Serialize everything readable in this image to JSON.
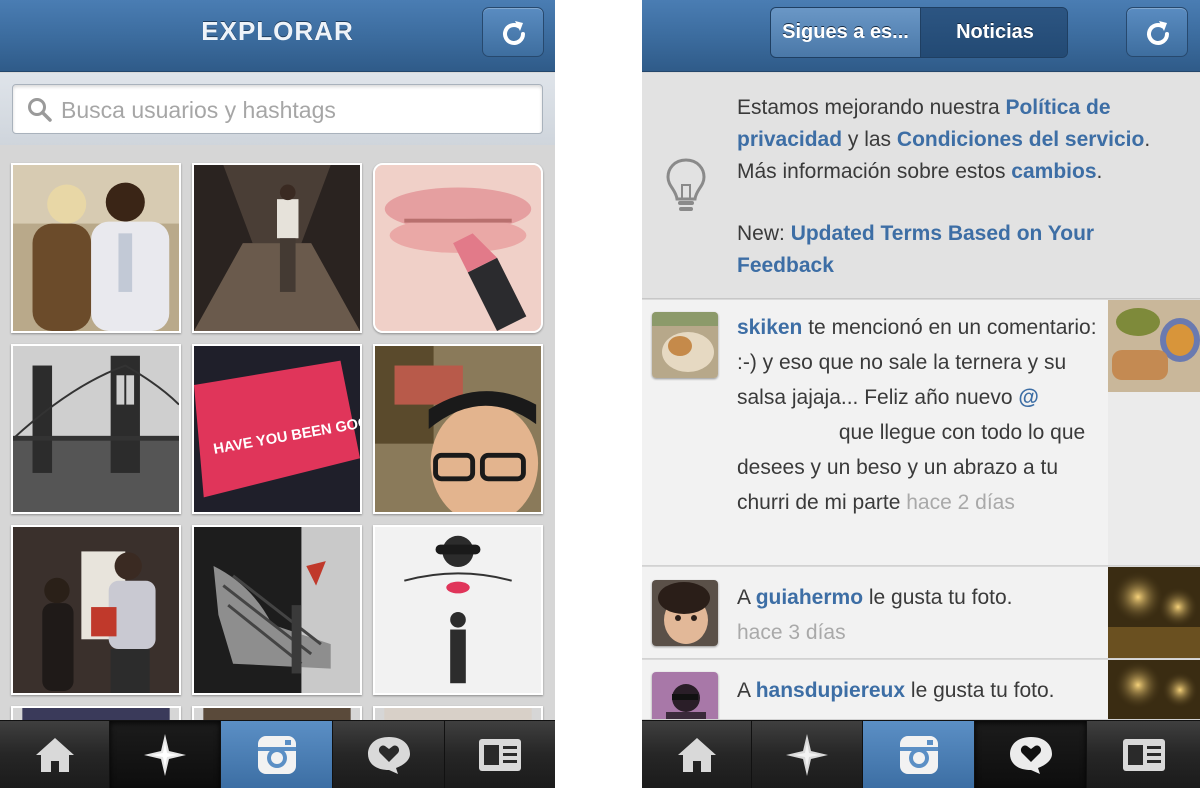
{
  "explore": {
    "title": "EXPLORAR",
    "search": {
      "placeholder": "Busca usuarios y hashtags"
    },
    "grid_tiles": [
      {
        "icon": "photo-couple"
      },
      {
        "icon": "photo-corridor"
      },
      {
        "icon": "photo-lips-lipstick"
      },
      {
        "icon": "photo-brooklyn-bridge"
      },
      {
        "icon": "photo-card",
        "text": "HAVE YOU BEEN GOOD THIS YEAR?"
      },
      {
        "icon": "photo-selfie-glasses"
      },
      {
        "icon": "photo-mirror-selfie"
      },
      {
        "icon": "photo-high-heel"
      },
      {
        "icon": "photo-fashion-sketch"
      }
    ]
  },
  "news": {
    "tabs": [
      {
        "label": "Sigues a es..."
      },
      {
        "label": "Noticias"
      }
    ],
    "notice": {
      "t1": "Estamos mejorando nuestra ",
      "link1": "Política de privacidad",
      "t2": " y las ",
      "link2": "Condiciones del servicio",
      "t3": ". Más información sobre estos ",
      "link3": "cambios",
      "t4": ".",
      "new_prefix": "New: ",
      "new_link": "Updated Terms Based on Your Feedback"
    },
    "items": [
      {
        "user": "skiken",
        "text_before": " te mencionó en un comentario: :-) y eso que no sale la ternera y su salsa jajaja... Feliz año nuevo ",
        "at": "@",
        "text_after": " que llegue con todo lo que desees y un beso y un abrazo a tu churri de mi parte",
        "time": "hace 2 días"
      },
      {
        "prefix": "A ",
        "user": "guiahermo",
        "text": " le gusta tu foto.",
        "time": "hace 3 días"
      },
      {
        "prefix": "A ",
        "user": "hansdupiereux",
        "text": " le gusta tu foto."
      }
    ]
  },
  "tabbar": {
    "items": [
      {
        "icon": "home-icon"
      },
      {
        "icon": "explore-star-icon"
      },
      {
        "icon": "camera-icon"
      },
      {
        "icon": "news-heart-bubble-icon"
      },
      {
        "icon": "profile-card-icon"
      }
    ]
  },
  "colors": {
    "header_blue": "#3b6b9d",
    "link_blue": "#3d6ea5",
    "time_gray": "#a9a9a9"
  }
}
